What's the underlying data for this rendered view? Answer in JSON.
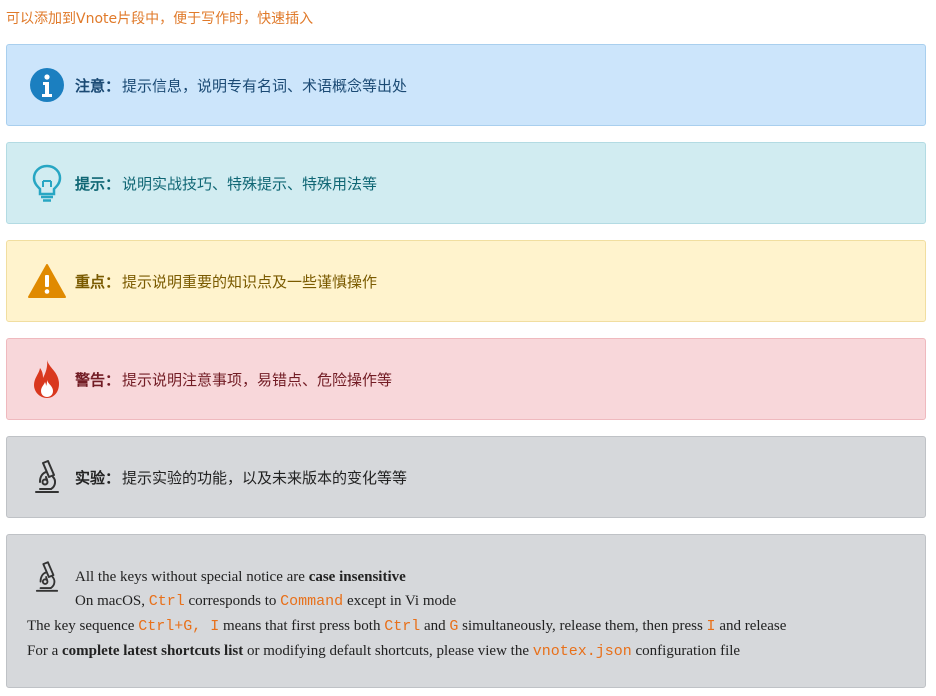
{
  "intro": "可以添加到Vnote片段中，便于写作时，快速插入",
  "callouts": [
    {
      "label": "注意：",
      "text": "提示信息，说明专有名词、术语概念等出处",
      "icon": "info-icon"
    },
    {
      "label": "提示：",
      "text": "说明实战技巧、特殊提示、特殊用法等",
      "icon": "lightbulb-icon"
    },
    {
      "label": "重点：",
      "text": "提示说明重要的知识点及一些谨慎操作",
      "icon": "warning-icon"
    },
    {
      "label": "警告：",
      "text": "提示说明注意事项，易错点、危险操作等",
      "icon": "fire-icon"
    },
    {
      "label": "实验：",
      "text": "提示实验的功能，以及未来版本的变化等等",
      "icon": "microscope-icon"
    }
  ],
  "note": {
    "icon": "microscope-icon",
    "l1_a": "All the keys without special notice are ",
    "l1_b": "case insensitive",
    "l2_a": "On macOS, ",
    "l2_code1": "Ctrl",
    "l2_b": " corresponds to ",
    "l2_code2": "Command",
    "l2_c": " except in Vi mode",
    "l3_a": "The key sequence ",
    "l3_code1": "Ctrl+G, I",
    "l3_b": " means that first press both ",
    "l3_code2": "Ctrl",
    "l3_c": " and ",
    "l3_code3": "G",
    "l3_d": " simultaneously, release them, then press ",
    "l3_code4": "I",
    "l3_e": " and release",
    "l4_a": "For a ",
    "l4_b": "complete latest shortcuts list",
    "l4_c": " or modifying default shortcuts, please view the ",
    "l4_code": "vnotex.json",
    "l4_d": " configuration file"
  },
  "colors": {
    "info": "#1b7fc0",
    "tip": "#27a6c3",
    "warning": "#e08a00",
    "danger": "#d9381e",
    "experiment": "#333333"
  }
}
